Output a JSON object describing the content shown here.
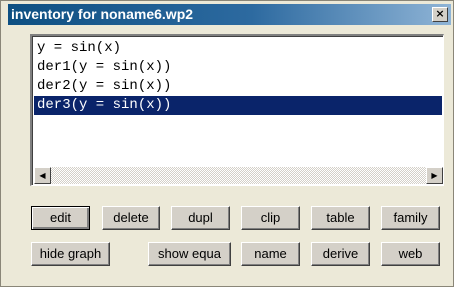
{
  "window": {
    "title": "inventory for noname6.wp2",
    "close_glyph": "×"
  },
  "list": {
    "items": [
      "y = sin(x)",
      "der1(y = sin(x))",
      "der2(y = sin(x))",
      "der3(y = sin(x))"
    ],
    "selected_index": 3
  },
  "scrollbar": {
    "left_glyph": "◀",
    "right_glyph": "▶"
  },
  "buttons": {
    "edit": "edit",
    "delete": "delete",
    "dupl": "dupl",
    "clip": "clip",
    "table": "table",
    "family": "family",
    "hide_graph": "hide graph",
    "show_equa": "show equa",
    "name": "name",
    "derive": "derive",
    "web": "web"
  },
  "colors": {
    "selection": "#0a246a",
    "title_bar": "#0d4f82",
    "dialog_bg": "#ece9d8"
  }
}
